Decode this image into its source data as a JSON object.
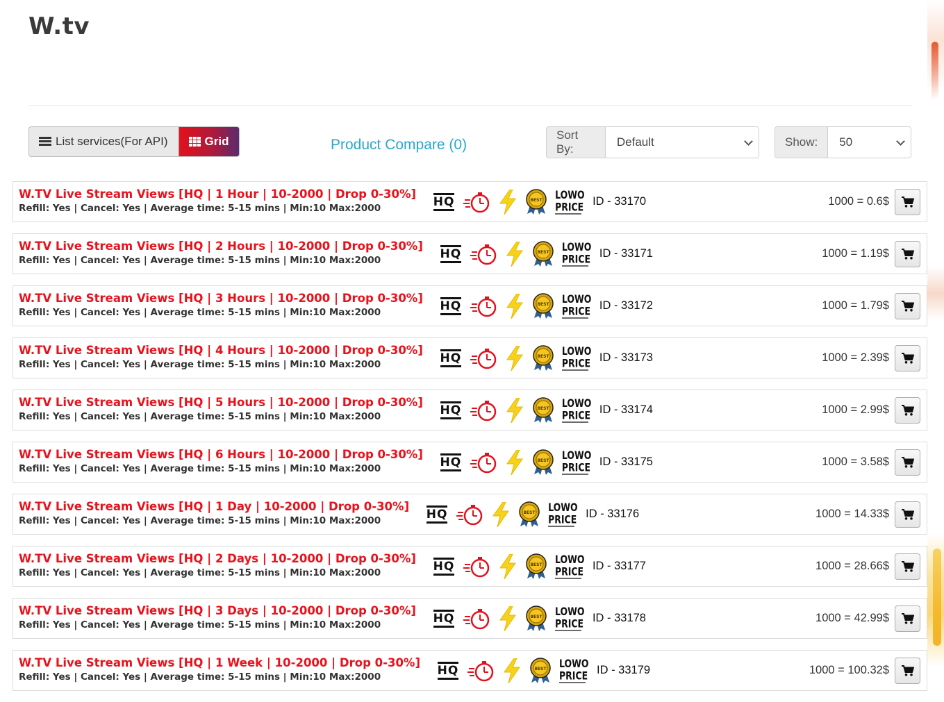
{
  "site": {
    "title": "W.tv"
  },
  "toolbar": {
    "list_label": "List services(For API)",
    "grid_label": "Grid",
    "compare_label": "Product Compare (0)",
    "sort_label": "Sort By:",
    "sort_value": "Default",
    "show_label": "Show:",
    "show_value": "50"
  },
  "badges": {
    "hq": "HQ",
    "lowo_top": "LOWO",
    "lowo_bottom": "PRICE",
    "best": "BEST"
  },
  "services": [
    {
      "title": "W.TV Live Stream Views [HQ | 1 Hour | 10-2000 | Drop 0-30%]",
      "meta": "Refill: Yes | Cancel: Yes | Average time: 5-15 mins | Min:10 Max:2000",
      "id": "ID - 33170",
      "price": "1000 = 0.6$"
    },
    {
      "title": "W.TV Live Stream Views [HQ | 2 Hours | 10-2000 | Drop 0-30%]",
      "meta": "Refill: Yes | Cancel: Yes | Average time: 5-15 mins | Min:10 Max:2000",
      "id": "ID - 33171",
      "price": "1000 = 1.19$"
    },
    {
      "title": "W.TV Live Stream Views [HQ | 3 Hours | 10-2000 | Drop 0-30%]",
      "meta": "Refill: Yes | Cancel: Yes | Average time: 5-15 mins | Min:10 Max:2000",
      "id": "ID - 33172",
      "price": "1000 = 1.79$"
    },
    {
      "title": "W.TV Live Stream Views [HQ | 4 Hours | 10-2000 | Drop 0-30%]",
      "meta": "Refill: Yes | Cancel: Yes | Average time: 5-15 mins | Min:10 Max:2000",
      "id": "ID - 33173",
      "price": "1000 = 2.39$"
    },
    {
      "title": "W.TV Live Stream Views [HQ | 5 Hours | 10-2000 | Drop 0-30%]",
      "meta": "Refill: Yes | Cancel: Yes | Average time: 5-15 mins | Min:10 Max:2000",
      "id": "ID - 33174",
      "price": "1000 = 2.99$"
    },
    {
      "title": "W.TV Live Stream Views [HQ | 6 Hours | 10-2000 | Drop 0-30%]",
      "meta": "Refill: Yes | Cancel: Yes | Average time: 5-15 mins | Min:10 Max:2000",
      "id": "ID - 33175",
      "price": "1000 = 3.58$"
    },
    {
      "title": "W.TV Live Stream Views [HQ | 1 Day | 10-2000 | Drop 0-30%]",
      "meta": "Refill: Yes | Cancel: Yes | Average time: 5-15 mins | Min:10 Max:2000",
      "id": "ID - 33176",
      "price": "1000 = 14.33$"
    },
    {
      "title": "W.TV Live Stream Views [HQ | 2 Days | 10-2000 | Drop 0-30%]",
      "meta": "Refill: Yes | Cancel: Yes | Average time: 5-15 mins | Min:10 Max:2000",
      "id": "ID - 33177",
      "price": "1000 = 28.66$"
    },
    {
      "title": "W.TV Live Stream Views [HQ | 3 Days | 10-2000 | Drop 0-30%]",
      "meta": "Refill: Yes | Cancel: Yes | Average time: 5-15 mins | Min:10 Max:2000",
      "id": "ID - 33178",
      "price": "1000 = 42.99$"
    },
    {
      "title": "W.TV Live Stream Views [HQ | 1 Week | 10-2000 | Drop 0-30%]",
      "meta": "Refill: Yes | Cancel: Yes | Average time: 5-15 mins | Min:10 Max:2000",
      "id": "ID - 33179",
      "price": "1000 = 100.32$"
    }
  ],
  "colors": {
    "title_red": "#e8121c",
    "compare_blue": "#2aa7c9",
    "grid_gradient_start": "#e3101c",
    "grid_gradient_end": "#5b2a6e"
  },
  "icons": [
    "list-icon",
    "grid-icon",
    "chevron-down-icon",
    "hq-icon",
    "stopwatch-icon",
    "lightning-icon",
    "best-medal-icon",
    "lowo-price-icon",
    "cart-icon"
  ]
}
